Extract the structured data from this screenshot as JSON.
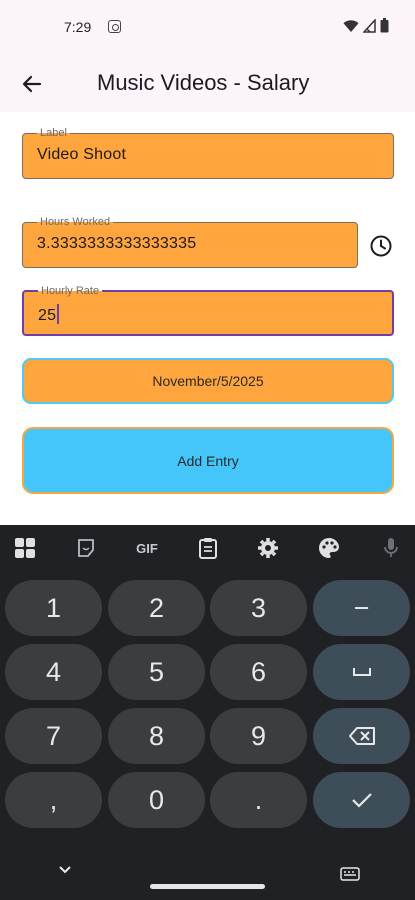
{
  "status_bar": {
    "time": "7:29",
    "icons": [
      "instagram-icon",
      "wifi-icon",
      "signal-icon",
      "battery-icon"
    ]
  },
  "app_bar": {
    "back_icon": "arrow-back-icon",
    "title": "Music Videos - Salary"
  },
  "form": {
    "label_field": {
      "label": "Label",
      "value": "Video Shoot"
    },
    "hours_field": {
      "label": "Hours Worked",
      "value": "3.3333333333333335"
    },
    "clock_icon": "clock-icon",
    "rate_field": {
      "label": "Hourly Rate",
      "value": "25"
    },
    "date_button": "November/5/2025",
    "add_button": "Add Entry"
  },
  "keyboard": {
    "toolbar": [
      "apps-grid-icon",
      "sticker-icon",
      "GIF",
      "clipboard-icon",
      "settings-icon",
      "palette-icon",
      "microphone-icon"
    ],
    "gif_label": "GIF",
    "keys": [
      "1",
      "2",
      "3",
      "−",
      "4",
      "5",
      "6",
      "␣",
      "7",
      "8",
      "9",
      "backspace",
      ",",
      "0",
      ".",
      "done"
    ],
    "row1": [
      "1",
      "2",
      "3",
      "−"
    ],
    "row2": [
      "4",
      "5",
      "6",
      "space"
    ],
    "row3": [
      "7",
      "8",
      "9",
      "backspace"
    ],
    "row4": [
      ",",
      "0",
      ".",
      "check"
    ]
  },
  "colors": {
    "field_fill": "#ffa53d",
    "date_border": "#53c8f5",
    "add_fill": "#44c6fb",
    "add_border": "#f6a73f",
    "focus_border": "#6e3fa8",
    "keyboard_bg": "#202125"
  }
}
